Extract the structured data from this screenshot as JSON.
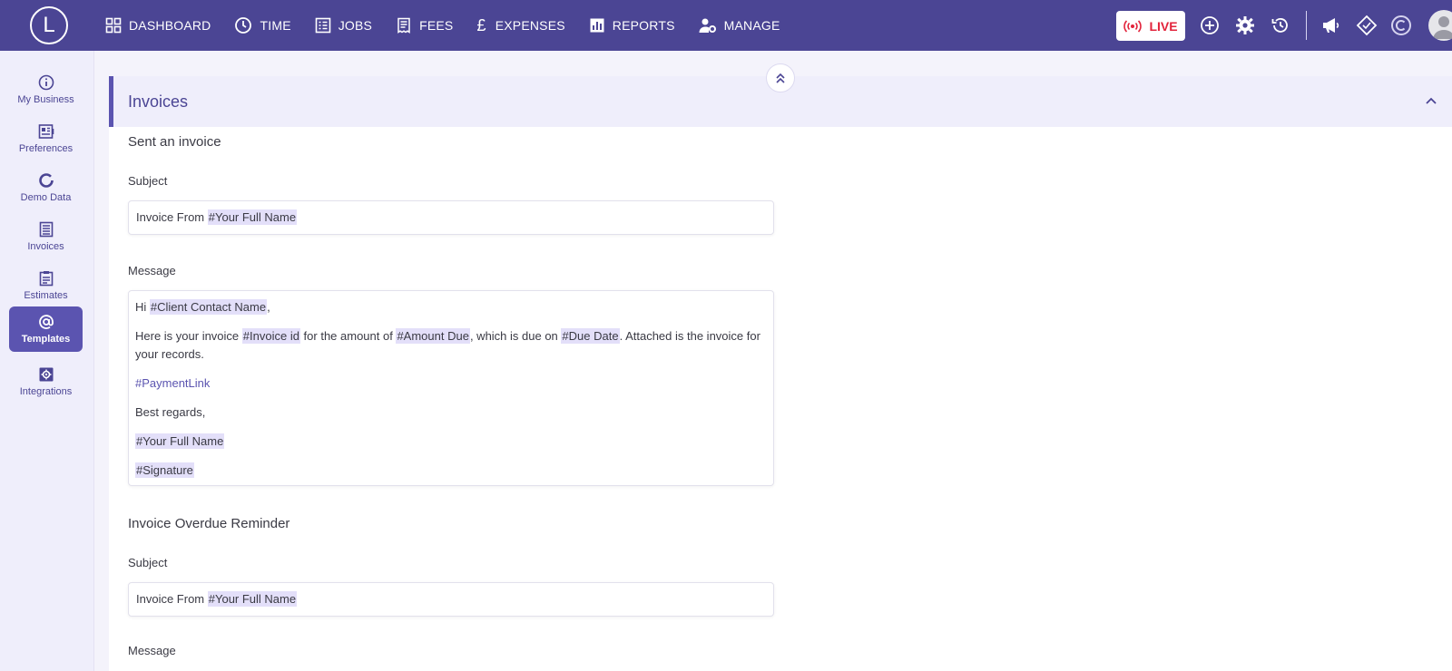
{
  "app": {
    "logo_letter": "L"
  },
  "nav": [
    {
      "label": "DASHBOARD",
      "icon": "grid-icon"
    },
    {
      "label": "TIME",
      "icon": "clock-icon"
    },
    {
      "label": "JOBS",
      "icon": "list-icon"
    },
    {
      "label": "FEES",
      "icon": "receipt-icon"
    },
    {
      "label": "EXPENSES",
      "icon": "pound-icon"
    },
    {
      "label": "REPORTS",
      "icon": "chart-icon"
    },
    {
      "label": "MANAGE",
      "icon": "user-gear-icon"
    }
  ],
  "topbar": {
    "live_label": "LIVE"
  },
  "sidebar": {
    "items": [
      {
        "label": "My Business",
        "icon": "info-icon"
      },
      {
        "label": "Preferences",
        "icon": "preferences-icon"
      },
      {
        "label": "Demo Data",
        "icon": "ring-icon"
      },
      {
        "label": "Invoices",
        "icon": "document-icon"
      },
      {
        "label": "Estimates",
        "icon": "clipboard-icon"
      },
      {
        "label": "Templates",
        "icon": "at-icon"
      },
      {
        "label": "Integrations",
        "icon": "integrations-icon"
      }
    ],
    "active": "Templates"
  },
  "section": {
    "title": "Invoices"
  },
  "sent_invoice": {
    "title": "Sent an invoice",
    "subject_label": "Subject",
    "subject_prefix": "Invoice From ",
    "subject_tag": "#Your Full Name",
    "message_label": "Message",
    "message": {
      "greeting_prefix": "Hi ",
      "greeting_tag": "#Client Contact Name",
      "greeting_suffix": ",",
      "line1_a": "Here is your invoice ",
      "line1_tag1": "#Invoice id",
      "line1_b": " for the amount of ",
      "line1_tag2": "#Amount Due",
      "line1_c": ", which is due on ",
      "line1_tag3": "#Due Date",
      "line1_d": ". Attached is the invoice for your records.",
      "payment_link": "#PaymentLink",
      "regards": "Best regards,",
      "name_tag": "#Your Full Name",
      "signature_tag": "#Signature"
    }
  },
  "overdue_reminder": {
    "title": "Invoice Overdue Reminder",
    "subject_label": "Subject",
    "subject_prefix": "Invoice From ",
    "subject_tag": "#Your Full Name",
    "message_label": "Message"
  },
  "colors": {
    "brand": "#4b4594",
    "accent": "#5b54b0",
    "live": "#e2233b",
    "tag_bg": "#e3dff9"
  }
}
